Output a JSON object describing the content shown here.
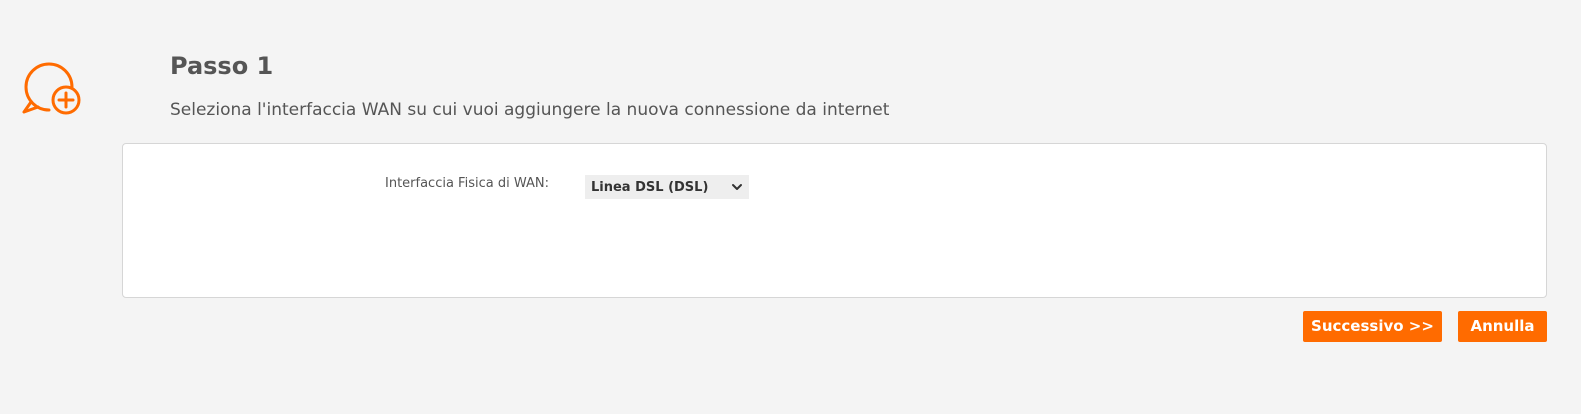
{
  "header": {
    "icon": "add-connection-icon",
    "title": "Passo 1",
    "description": "Seleziona l'interfaccia WAN su cui vuoi aggiungere la nuova connessione da internet"
  },
  "form": {
    "wan_interface_label": "Interfaccia Fisica di WAN:",
    "wan_interface_value": "Linea DSL (DSL)",
    "wan_interface_icon": "chevron-down-icon"
  },
  "actions": {
    "next_label": "Successivo >>",
    "cancel_label": "Annulla"
  },
  "colors": {
    "accent": "#ff6b00",
    "background": "#f4f4f4",
    "text": "#555555"
  }
}
